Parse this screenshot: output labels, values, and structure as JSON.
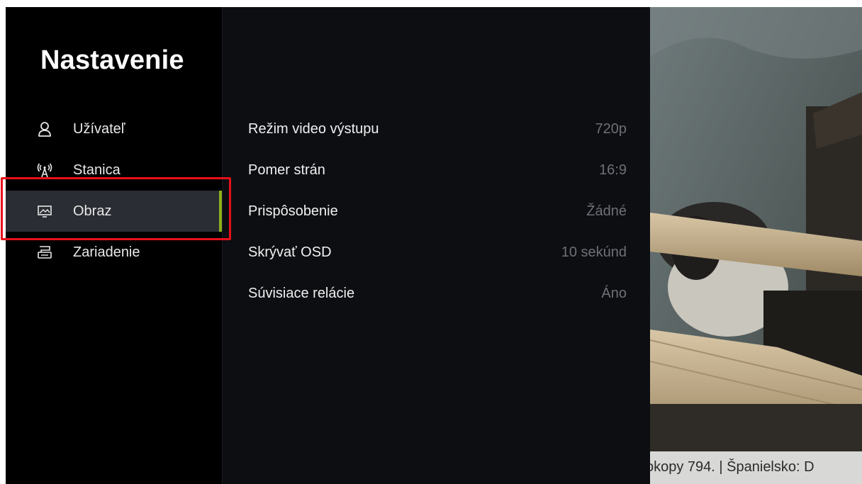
{
  "page": {
    "title": "Nastavenie"
  },
  "sidebar": {
    "items": [
      {
        "label": "Užívateľ",
        "icon": "user-icon",
        "active": false
      },
      {
        "label": "Stanica",
        "icon": "antenna-icon",
        "active": false
      },
      {
        "label": "Obraz",
        "icon": "picture-icon",
        "active": true
      },
      {
        "label": "Zariadenie",
        "icon": "device-icon",
        "active": false
      }
    ]
  },
  "settings": {
    "rows": [
      {
        "label": "Režim video výstupu",
        "value": "720p"
      },
      {
        "label": "Pomer strán",
        "value": "16:9"
      },
      {
        "label": "Prispôsobenie",
        "value": "Žádné"
      },
      {
        "label": "Skrývať OSD",
        "value": "10 sekúnd"
      },
      {
        "label": "Súvisiace relácie",
        "value": "Áno"
      }
    ]
  },
  "video": {
    "ticker_text": "okopy 794.  |  Španielsko: D"
  },
  "colors": {
    "accent": "#8fae1b",
    "active_bg": "#2a2d33",
    "highlight": "#e8111b",
    "value_text": "#6d7076"
  }
}
